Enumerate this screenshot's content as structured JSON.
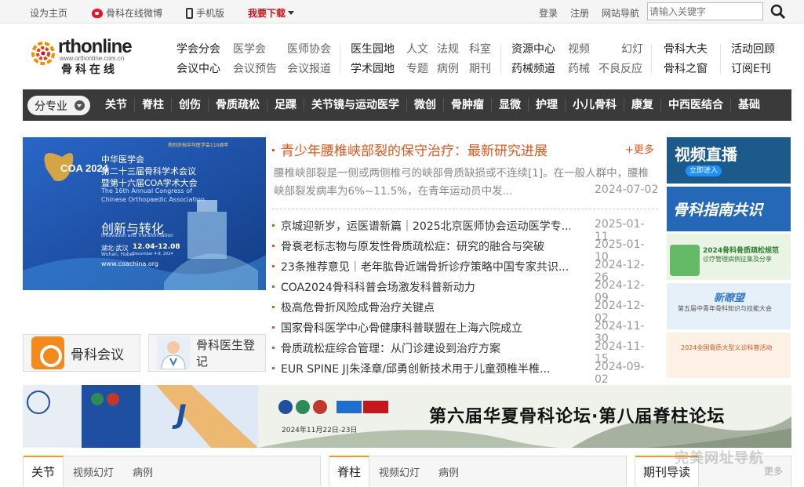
{
  "topbar": {
    "set_home": "设为主页",
    "weibo": "骨科在线微博",
    "mobile": "手机版",
    "download": "我要下载",
    "login": "登录",
    "register": "注册",
    "site_nav": "网站导航",
    "search_placeholder": "请输入关键字"
  },
  "logo": {
    "main": "rthonline",
    "url": "www.orthonline.com.cn",
    "cn": "骨科在线"
  },
  "header_links": {
    "g1": [
      "学会分会",
      "医学会",
      "医师协会",
      "会议中心",
      "会议预告",
      "会议报道"
    ],
    "g2": [
      "医生园地",
      "人文",
      "法规",
      "科室",
      "学术园地",
      "专题",
      "病例",
      "期刊"
    ],
    "g3": [
      "资源中心",
      "视频",
      "幻灯",
      "药械频道",
      "药械",
      "不良反应"
    ],
    "g4": [
      "骨科大夫",
      "骨科之窗"
    ],
    "g5": [
      "活动回顾",
      "订阅E刊"
    ]
  },
  "nav": {
    "category_label": "分专业",
    "items": [
      "关节",
      "脊柱",
      "创伤",
      "骨质疏松",
      "足踝",
      "关节镜与运动医学",
      "微创",
      "骨肿瘤",
      "显微",
      "护理",
      "小儿骨科",
      "康复",
      "中西医结合",
      "基础"
    ]
  },
  "banner": {
    "line1": "中华医学会",
    "line2": "第二十三届骨科学术会议",
    "line3": "暨第十六届COA学术大会",
    "en1": "The 16th Annual Congress of",
    "en2": "Chinese Orthopaedic Association",
    "slogan": "创新与转化",
    "slogan_en": "Innovation and Transformation",
    "place": "湖北·武汉",
    "place_en": "Wuhan, Hubei",
    "date": "12.04-12.08",
    "date_en": "December 4-8, 2024",
    "site": "www.coachina.org",
    "badge": "COA 2024",
    "anniv": "热烈庆祝中华医学会110周年"
  },
  "quick_buttons": {
    "meeting": "骨科会议",
    "doctor": "骨科医生登记"
  },
  "headline": {
    "title": "青少年腰椎峡部裂的保守治疗：最新研究进展",
    "more": "+更多",
    "summary": "腰椎峡部裂是一侧或两侧椎弓的峡部骨质缺损或不连续[1]。在一般人群中，腰椎峡部裂发病率为6%~11.5%，在青年运动员中发...",
    "date": "2024-07-02"
  },
  "news": [
    {
      "title": "京城迎新岁，运医谱新篇｜2025北京医师协会运动医学专...",
      "date": "2025-01-11"
    },
    {
      "title": "骨衰老标志物与原发性骨质疏松症：研究的融合与突破",
      "date": "2025-01-10"
    },
    {
      "title": "23条推荐意见｜老年肱骨近端骨折诊疗策略中国专家共识...",
      "date": "2024-12-26"
    },
    {
      "title": "COA2024骨科科普会场激发科普新动力",
      "date": "2024-12-09"
    },
    {
      "title": "极高危骨折风险成骨治疗关键点",
      "date": "2024-12-02"
    },
    {
      "title": "国家骨科医学中心骨健康科普联盟在上海六院成立",
      "date": "2024-11-30"
    },
    {
      "title": "骨质疏松症综合管理：从门诊建设到治疗方案",
      "date": "2024-11-15"
    },
    {
      "title": "EUR SPINE J|朱泽章/邱勇创新技术用于儿童颈椎半椎...",
      "date": "2024-09-02"
    }
  ],
  "side_ads": {
    "video": "视频直播",
    "video_btn": "立即进入",
    "guide": "骨科指南共识",
    "case_title": "2024骨科骨质疏松规范",
    "case_sub": "诊疗管理病例征集及分享",
    "newlook": "新瞭望",
    "newlook_sub": "第五届中青年骨科知识与技能大会",
    "activity": "2024全国骨质大型义诊科普活动"
  },
  "wide_banner": {
    "title": "第六届华夏骨科论坛·第八届脊柱论坛",
    "date": "2024年11月22日-23日",
    "mid_text": "J"
  },
  "tabs": {
    "box1": {
      "active": "关节",
      "subs": [
        "视频幻灯",
        "病例"
      ]
    },
    "box2": {
      "active": "脊柱",
      "subs": [
        "视频幻灯",
        "病例"
      ]
    },
    "box3": {
      "active": "期刊导读",
      "more": "更多"
    }
  },
  "watermark": "完美网址导航",
  "colors": {
    "accent": "#e0551c",
    "nav_bg": "#3a3a3a",
    "download": "#c8161d",
    "tab_active": "#f39c12"
  }
}
